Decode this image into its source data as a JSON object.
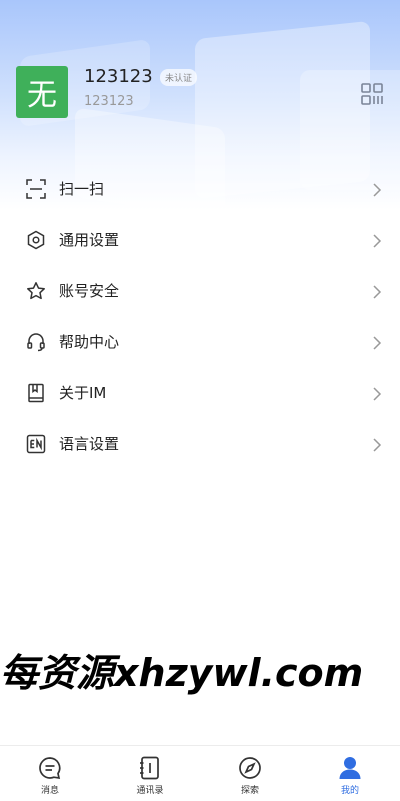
{
  "profile": {
    "avatar_char": "无",
    "name": "123123",
    "verify_badge": "未认证",
    "user_id": "123123",
    "qr_icon": "qr-code-icon"
  },
  "menu": {
    "items": [
      {
        "label": "扫一扫",
        "icon": "scan-icon"
      },
      {
        "label": "通用设置",
        "icon": "settings-hexagon-icon"
      },
      {
        "label": "账号安全",
        "icon": "star-icon"
      },
      {
        "label": "帮助中心",
        "icon": "headset-icon"
      },
      {
        "label": "关于IM",
        "icon": "book-icon"
      },
      {
        "label": "语言设置",
        "icon": "language-en-icon"
      }
    ]
  },
  "watermark": "每资源xhzywl.com",
  "tabbar": {
    "tabs": [
      {
        "label": "消息",
        "icon": "message-icon"
      },
      {
        "label": "通讯录",
        "icon": "contacts-icon"
      },
      {
        "label": "探索",
        "icon": "compass-icon"
      },
      {
        "label": "我的",
        "icon": "user-icon",
        "active": true
      }
    ]
  },
  "colors": {
    "accent": "#2f6de1",
    "avatar_bg": "#3fb05a",
    "header_gradient_top": "#a9c6fb"
  }
}
